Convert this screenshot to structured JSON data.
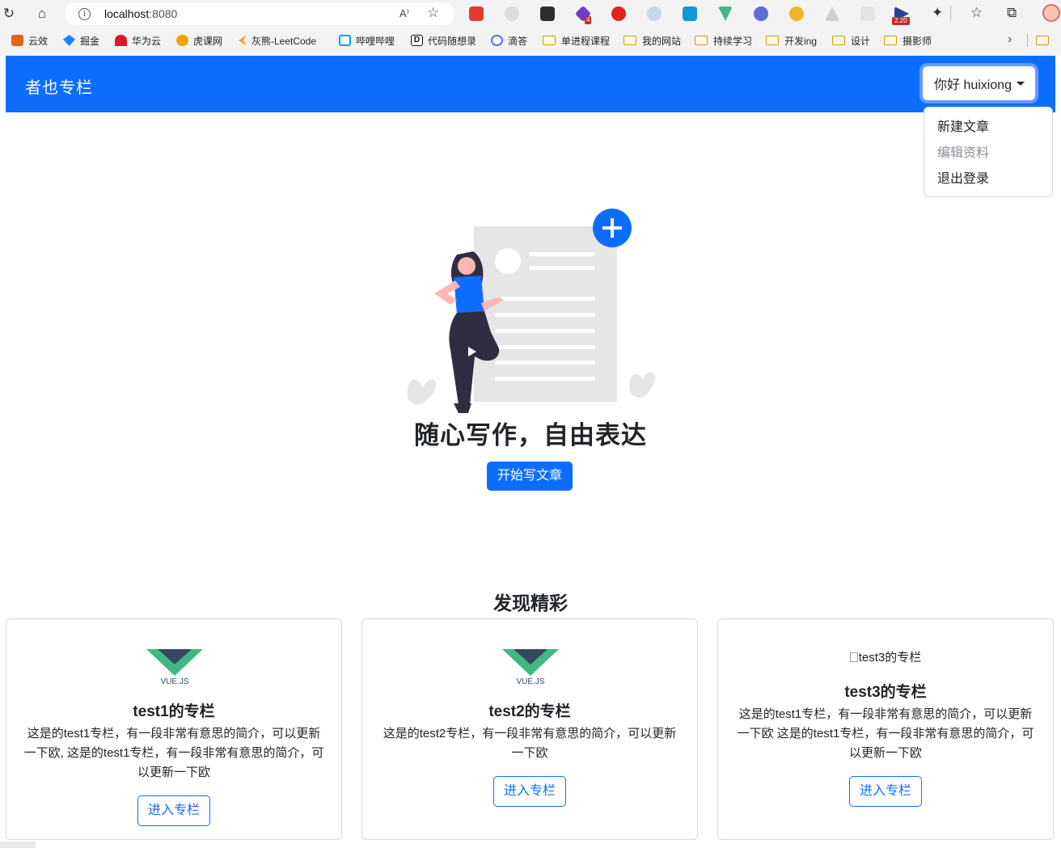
{
  "browser": {
    "url_host": "localhost",
    "url_port": ":8080",
    "read_aloud_label": "A⁾",
    "badges": {
      "ext_count": "4",
      "ext_version": "2.20"
    },
    "bookmarks": [
      {
        "label": "云效",
        "color": "#e8601c"
      },
      {
        "label": "掘金",
        "color": "#1e80ff"
      },
      {
        "label": "华为云",
        "color": "#e0162b"
      },
      {
        "label": "虎课网",
        "color": "#f2a20c"
      },
      {
        "label": "灰熊-LeetCode",
        "color": "#333333"
      },
      {
        "label": "哔哩哔哩",
        "color": "#00a1d6"
      },
      {
        "label": "代码随想录",
        "color": "#111111"
      },
      {
        "label": "滴答",
        "color": "#4772fa"
      },
      {
        "label": "单进程课程",
        "color": "folder"
      },
      {
        "label": "我的网站",
        "color": "folder"
      },
      {
        "label": "持续学习",
        "color": "folder"
      },
      {
        "label": "开发ing",
        "color": "folder"
      },
      {
        "label": "设计",
        "color": "folder"
      },
      {
        "label": "摄影师",
        "color": "folder"
      }
    ]
  },
  "navbar": {
    "brand": "者也专栏",
    "user_button": "你好 huixiong"
  },
  "user_menu": {
    "new_article": "新建文章",
    "edit_profile": "编辑资料",
    "logout": "退出登录"
  },
  "hero": {
    "title": "随心写作，自由表达",
    "button": "开始写文章"
  },
  "discover": {
    "title": "发现精彩",
    "columns": [
      {
        "title": "test1的专栏",
        "logo": "vue-logo",
        "logo_text": "VUE.JS",
        "description": "这是的test1专栏，有一段非常有意思的简介，可以更新一下欧, 这是的test1专栏，有一段非常有意思的简介，可以更新一下欧",
        "button": "进入专栏"
      },
      {
        "title": "test2的专栏",
        "logo": "vue-logo",
        "logo_text": "VUE.JS",
        "description": "这是的test2专栏，有一段非常有意思的简介，可以更新一下欧",
        "button": "进入专栏"
      },
      {
        "title": "test3的专栏",
        "logo_alt": "test3的专栏",
        "description": "这是的test1专栏，有一段非常有意思的简介，可以更新一下欧 这是的test1专栏，有一段非常有意思的简介，可以更新一下欧",
        "button": "进入专栏"
      }
    ]
  },
  "colors": {
    "primary": "#0d6efd",
    "vue_green": "#41b883",
    "vue_dark": "#34495e",
    "illustration_gray": "#e6e6e6",
    "illustration_dark": "#2f2e41",
    "illustration_skin": "#ffb6b6"
  }
}
